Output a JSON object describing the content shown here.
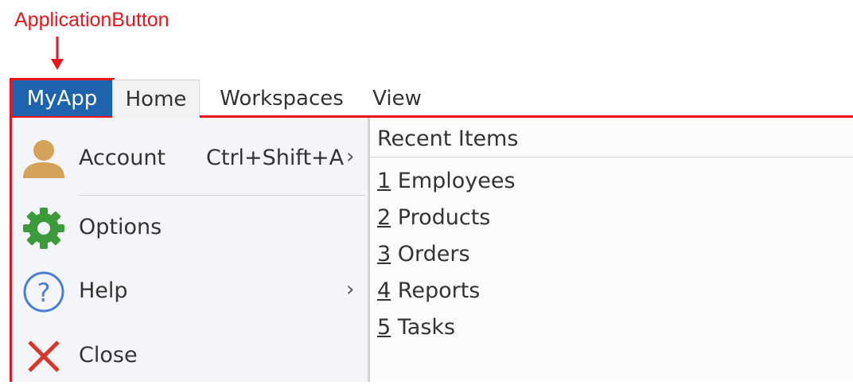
{
  "annotation": {
    "label": "ApplicationButton"
  },
  "ribbon": {
    "app_button": "MyApp",
    "tabs": [
      "Home",
      "Workspaces",
      "View"
    ]
  },
  "menu": {
    "items": [
      {
        "label": "Account",
        "shortcut": "Ctrl+Shift+A",
        "icon": "user-icon",
        "has_submenu": true
      },
      {
        "label": "Options",
        "icon": "gear-icon",
        "has_submenu": false
      },
      {
        "label": "Help",
        "icon": "help-icon",
        "has_submenu": true
      },
      {
        "label": "Close",
        "icon": "close-icon",
        "has_submenu": false
      }
    ],
    "chevron": "›"
  },
  "recent": {
    "header": "Recent Items",
    "items": [
      {
        "num": "1",
        "label": "Employees"
      },
      {
        "num": "2",
        "label": "Products"
      },
      {
        "num": "3",
        "label": "Orders"
      },
      {
        "num": "4",
        "label": "Reports"
      },
      {
        "num": "5",
        "label": "Tasks"
      }
    ]
  },
  "colors": {
    "annotation": "#e8151b",
    "app_button": "#1d63ad",
    "gear": "#3b9b3b",
    "help": "#4a7fd6",
    "close": "#d9362b",
    "user": "#d4a35a"
  }
}
